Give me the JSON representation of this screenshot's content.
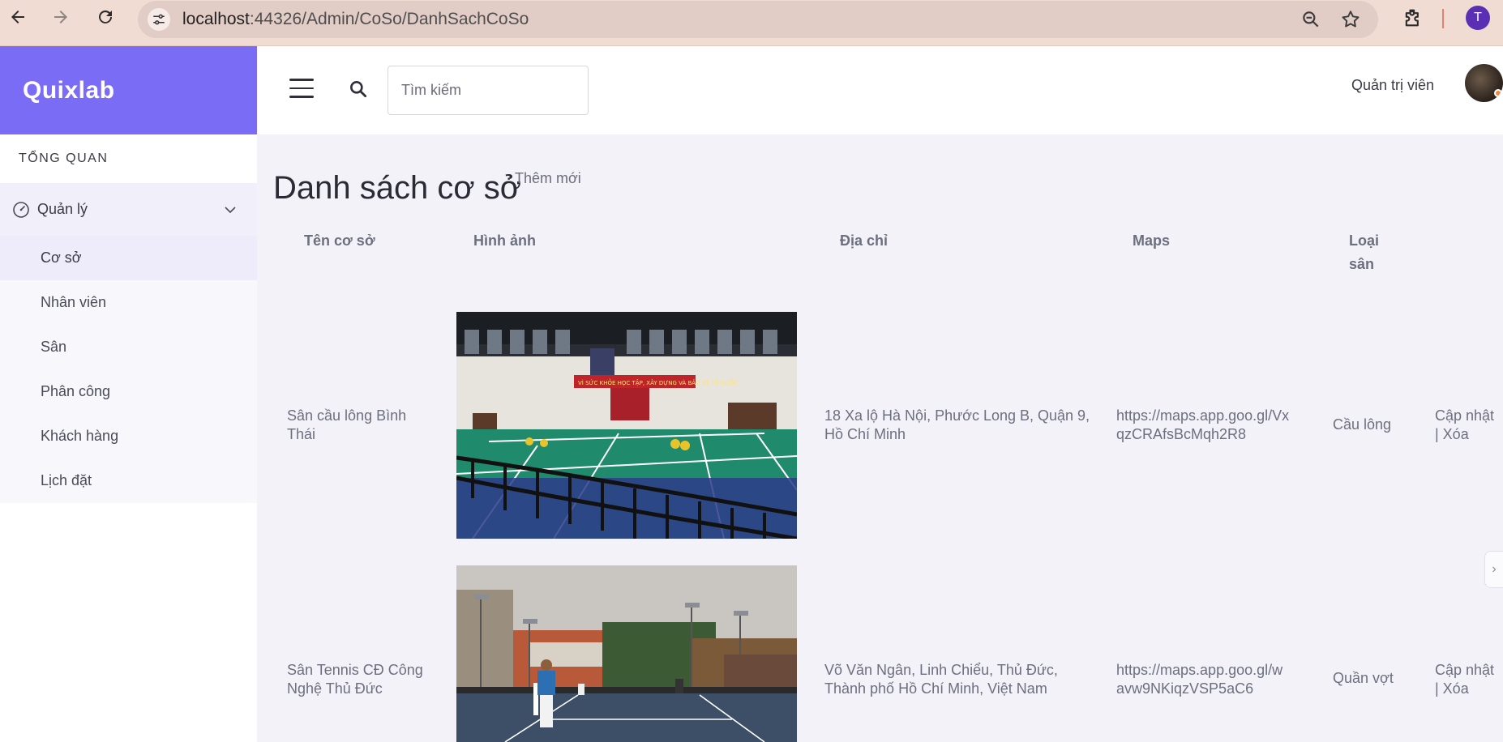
{
  "browser": {
    "url_host": "localhost",
    "url_rest": ":44326/Admin/CoSo/DanhSachCoSo",
    "profile_initial": "T"
  },
  "sidebar": {
    "brand": "Quixlab",
    "section_title": "TỔNG QUAN",
    "group_label": "Quản lý",
    "items": [
      {
        "label": "Cơ sở",
        "active": true
      },
      {
        "label": "Nhân viên"
      },
      {
        "label": "Sân"
      },
      {
        "label": "Phân công"
      },
      {
        "label": "Khách hàng"
      },
      {
        "label": "Lịch đặt"
      }
    ]
  },
  "topbar": {
    "search_placeholder": "Tìm kiếm",
    "admin_label": "Quản trị viên"
  },
  "main": {
    "title": "Danh sách cơ sở",
    "add_new": "Thêm mới",
    "columns": {
      "name": "Tên cơ sở",
      "image": "Hình ảnh",
      "address": "Địa chỉ",
      "maps": "Maps",
      "type_line1": "Loại",
      "type_line2": "sân"
    },
    "rows": [
      {
        "name_line1": "Sân cầu lông Bình",
        "name_line2": "Thái",
        "address_line1": "18 Xa lộ Hà Nội, Phước Long B, Quận 9,",
        "address_line2": "Hồ Chí Minh",
        "maps_line1": "https://maps.app.goo.gl/Vx",
        "maps_line2": "qzCRAfsBcMqh2R8",
        "type": "Cầu lông",
        "action_line1": "Cập nhật",
        "action_line2": "| Xóa",
        "banner": "VÌ SỨC KHỎE HỌC TẬP, XÂY DỰNG VÀ BẢO VỆ TỔ QUỐC"
      },
      {
        "name_line1": "Sân Tennis CĐ Công",
        "name_line2": "Nghệ Thủ Đức",
        "address_line1": "Võ Văn Ngân, Linh Chiểu, Thủ Đức,",
        "address_line2": "Thành phố Hồ Chí Minh, Việt Nam",
        "maps_line1": "https://maps.app.goo.gl/w",
        "maps_line2": "avw9NKiqzVSP5aC6",
        "type": "Quần vợt",
        "action_line1": "Cập nhật",
        "action_line2": "| Xóa"
      }
    ]
  },
  "icons": [
    "back-arrow-icon",
    "forward-arrow-icon",
    "reload-icon",
    "site-settings-icon",
    "zoom-icon",
    "star-icon",
    "extensions-icon",
    "hamburger-icon",
    "search-icon",
    "gauge-icon",
    "chevron-down-icon",
    "chevron-right-icon"
  ],
  "colors": {
    "brand": "#7b6cf6",
    "chrome": "#f1dcd4",
    "background": "#f3f2f8"
  }
}
